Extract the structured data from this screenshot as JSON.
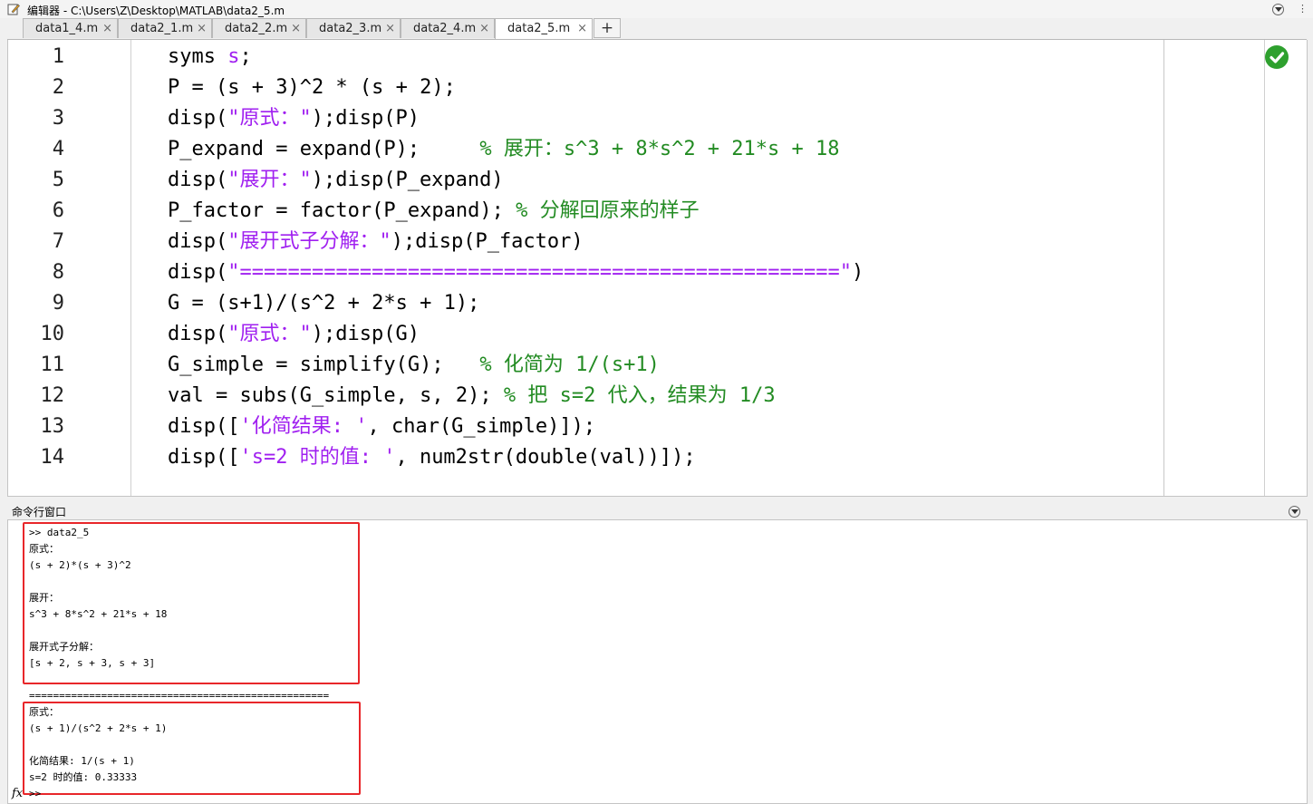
{
  "window": {
    "title": "编辑器 - C:\\Users\\Z\\Desktop\\MATLAB\\data2_5.m"
  },
  "tabs": [
    {
      "label": "data1_4.m",
      "active": false
    },
    {
      "label": "data2_1.m",
      "active": false
    },
    {
      "label": "data2_2.m",
      "active": false
    },
    {
      "label": "data2_3.m",
      "active": false
    },
    {
      "label": "data2_4.m",
      "active": false
    },
    {
      "label": "data2_5.m",
      "active": true
    }
  ],
  "add_tab_label": "+",
  "close_glyph": "×",
  "editor": {
    "line_numbers": [
      "1",
      "2",
      "3",
      "4",
      "5",
      "6",
      "7",
      "8",
      "9",
      "10",
      "11",
      "12",
      "13",
      "14"
    ],
    "lines": [
      [
        {
          "text": "syms ",
          "cls": ""
        },
        {
          "text": "s",
          "cls": "purple"
        },
        {
          "text": ";",
          "cls": ""
        }
      ],
      [
        {
          "text": "P = (s + 3)^2 * (s + 2);",
          "cls": ""
        }
      ],
      [
        {
          "text": "disp(",
          "cls": ""
        },
        {
          "text": "\"原式：\"",
          "cls": "purple"
        },
        {
          "text": ");disp(P)",
          "cls": ""
        }
      ],
      [
        {
          "text": "P_expand = expand(P);     ",
          "cls": ""
        },
        {
          "text": "% 展开：s^3 + 8*s^2 + 21*s + 18",
          "cls": "green"
        }
      ],
      [
        {
          "text": "disp(",
          "cls": ""
        },
        {
          "text": "\"展开：\"",
          "cls": "purple"
        },
        {
          "text": ");disp(P_expand)",
          "cls": ""
        }
      ],
      [
        {
          "text": "P_factor = factor(P_expand); ",
          "cls": ""
        },
        {
          "text": "% 分解回原来的样子",
          "cls": "green"
        }
      ],
      [
        {
          "text": "disp(",
          "cls": ""
        },
        {
          "text": "\"展开式子分解：\"",
          "cls": "purple"
        },
        {
          "text": ");disp(P_factor)",
          "cls": ""
        }
      ],
      [
        {
          "text": "disp(",
          "cls": ""
        },
        {
          "text": "\"==================================================\"",
          "cls": "purple"
        },
        {
          "text": ")",
          "cls": ""
        }
      ],
      [
        {
          "text": "G = (s+1)/(s^2 + 2*s + 1);",
          "cls": ""
        }
      ],
      [
        {
          "text": "disp(",
          "cls": ""
        },
        {
          "text": "\"原式：\"",
          "cls": "purple"
        },
        {
          "text": ");disp(G)",
          "cls": ""
        }
      ],
      [
        {
          "text": "G_simple = simplify(G);   ",
          "cls": ""
        },
        {
          "text": "% 化简为 1/(s+1)",
          "cls": "green"
        }
      ],
      [
        {
          "text": "val = subs(G_simple, s, 2); ",
          "cls": ""
        },
        {
          "text": "% 把 s=2 代入，结果为 1/3",
          "cls": "green"
        }
      ],
      [
        {
          "text": "disp([",
          "cls": ""
        },
        {
          "text": "'化简结果: '",
          "cls": "purple"
        },
        {
          "text": ", char(G_simple)]);",
          "cls": ""
        }
      ],
      [
        {
          "text": "disp([",
          "cls": ""
        },
        {
          "text": "'s=2 时的值: '",
          "cls": "purple"
        },
        {
          "text": ", num2str(double(val))]);",
          "cls": ""
        }
      ]
    ],
    "status_icon": "check-circle-icon"
  },
  "command_window": {
    "title": "命令行窗口",
    "lines": [
      ">> data2_5",
      "原式：",
      "(s + 2)*(s + 3)^2",
      "",
      "展开：",
      "s^3 + 8*s^2 + 21*s + 18",
      "",
      "展开式子分解：",
      "[s + 2, s + 3, s + 3]",
      "",
      "==================================================",
      "原式：",
      "(s + 1)/(s^2 + 2*s + 1)",
      "",
      "化简结果: 1/(s + 1)",
      "s=2 时的值: 0.33333",
      ">>"
    ],
    "prompt_icon": "fx-icon",
    "prompt_icon_text": "fx"
  },
  "colors": {
    "string": "#a020f0",
    "comment": "#228b22",
    "highlight_box": "#e8262a",
    "ok": "#2ea02e"
  }
}
